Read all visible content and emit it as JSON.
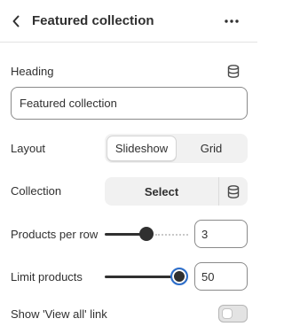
{
  "header": {
    "title": "Featured collection",
    "back_icon": "chevron-left-icon",
    "more_icon": "more-horizontal-icon"
  },
  "heading": {
    "label": "Heading",
    "value": "Featured collection",
    "icon": "database-icon"
  },
  "layout": {
    "label": "Layout",
    "options": [
      "Slideshow",
      "Grid"
    ],
    "selected": "Slideshow"
  },
  "collection": {
    "label": "Collection",
    "button_label": "Select",
    "icon": "database-icon"
  },
  "products_per_row": {
    "label": "Products per row",
    "value": "3",
    "slider_fraction": 0.5
  },
  "limit_products": {
    "label": "Limit products",
    "value": "50",
    "slider_fraction": 1.0
  },
  "show_view_all": {
    "label": "Show 'View all' link",
    "enabled": false
  },
  "colors": {
    "text": "#303030",
    "border": "#8a8a8a",
    "focus_ring": "#2c6ecb",
    "segment_bg": "#f1f1f1"
  }
}
